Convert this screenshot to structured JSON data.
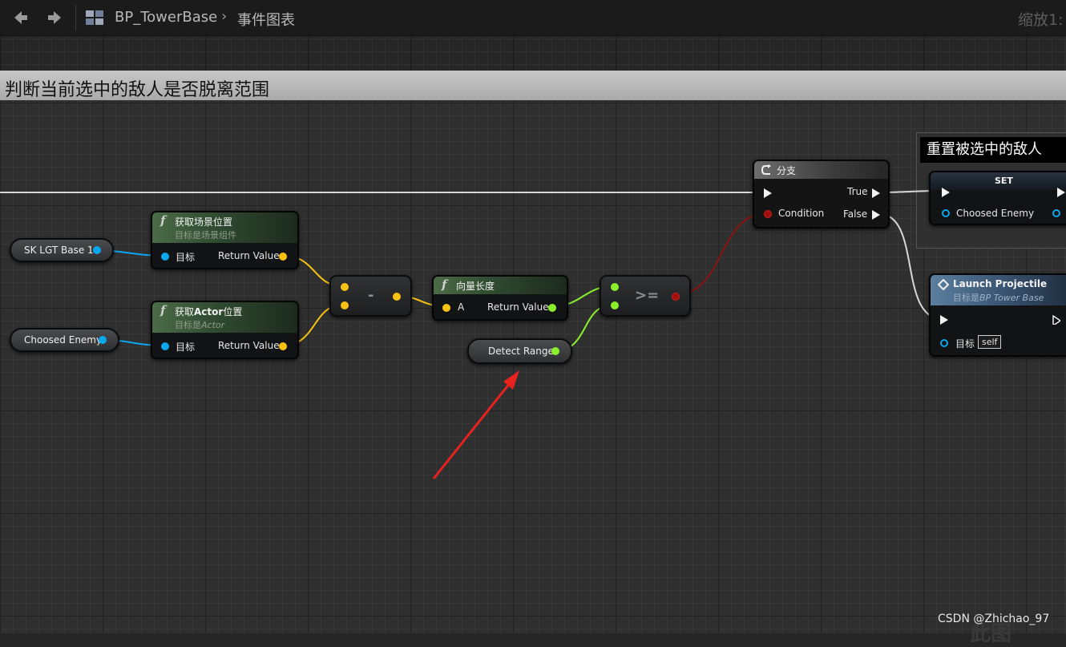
{
  "toolbar": {
    "blueprint_name": "BP_TowerBase",
    "graph_name": "事件图表",
    "zoom_label": "缩放1:"
  },
  "comments": {
    "main_title": "判断当前选中的敌人是否脱离范围",
    "reset_title": "重置被选中的敌人"
  },
  "nodes": {
    "var_sk": "SK LGT Base 1",
    "var_enemy": "Choosed Enemy",
    "getloc1_title": "获取场景位置",
    "getloc1_sub": "目标是场景组件",
    "getloc1_target": "目标",
    "getloc1_ret": "Return Value",
    "getloc2_title_a": "获取",
    "getloc2_title_b": "Actor",
    "getloc2_title_c": "位置",
    "getloc2_sub_a": "目标是",
    "getloc2_sub_b": "Actor",
    "getloc2_target": "目标",
    "getloc2_ret": "Return Value",
    "subtract_op": "-",
    "veclen_title": "向量长度",
    "veclen_a": "A",
    "veclen_ret": "Return Value",
    "gte_op": ">=",
    "detect_range": "Detect Range",
    "branch_title": "分支",
    "branch_true": "True",
    "branch_condition": "Condition",
    "branch_false": "False",
    "set_title": "SET",
    "set_var": "Choosed Enemy",
    "launch_title": "Launch Projectile",
    "launch_sub_a": "目标是",
    "launch_sub_b": "BP Tower Base",
    "launch_target": "目标",
    "launch_self": "self"
  },
  "watermark": "CSDN @Zhichao_97",
  "bottom_watermark": "此图",
  "colors": {
    "object_pin": "#0aa6f0",
    "vector_pin": "#f7c212",
    "float_pin": "#8af02c",
    "bool_pin": "#a30e0e",
    "annotation_arrow": "#e8221e"
  },
  "icons": {
    "back": "arrow-left-icon",
    "forward": "arrow-right-icon",
    "blueprint": "blueprint-grid-icon",
    "breadcrumb_sep": "chevron-right-icon",
    "function": "function-icon",
    "branch": "branch-icon",
    "event": "diamond-icon"
  }
}
